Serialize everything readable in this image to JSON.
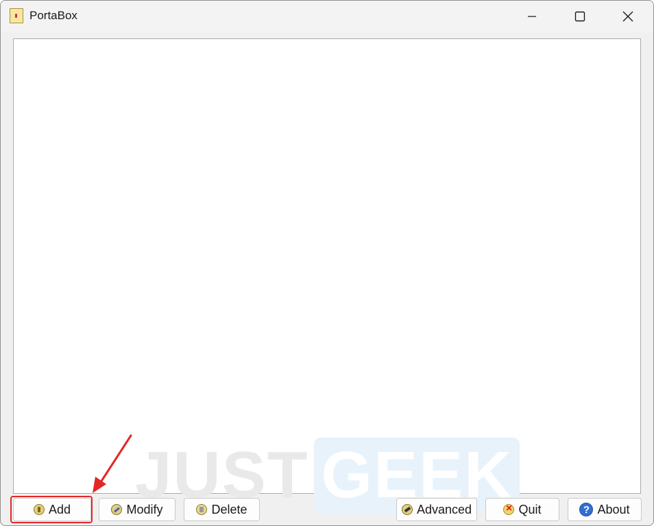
{
  "window": {
    "title": "PortaBox",
    "controls": {
      "minimize_icon": "minimize-icon",
      "maximize_icon": "maximize-icon",
      "close_icon": "close-icon"
    }
  },
  "list": {
    "items": []
  },
  "watermark": {
    "part1": "JUST",
    "part2": "GEEK"
  },
  "buttons": {
    "add": {
      "label": "Add",
      "icon": "add-icon"
    },
    "modify": {
      "label": "Modify",
      "icon": "modify-icon"
    },
    "delete": {
      "label": "Delete",
      "icon": "delete-icon"
    },
    "advanced": {
      "label": "Advanced",
      "icon": "advanced-icon"
    },
    "quit": {
      "label": "Quit",
      "icon": "quit-icon"
    },
    "about": {
      "label": "About",
      "icon": "help-icon",
      "glyph": "?"
    }
  },
  "annotation": {
    "highlight_color": "#e32626"
  }
}
